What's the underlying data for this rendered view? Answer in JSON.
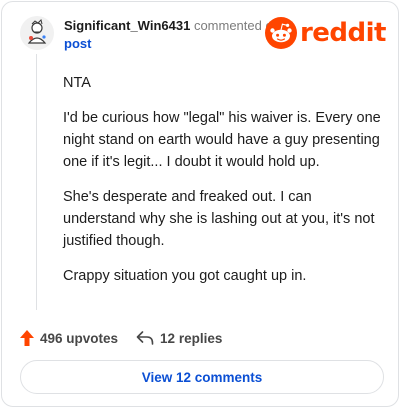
{
  "comment": {
    "author": "Significant_Win6431",
    "action_text": "commented on",
    "target_link": "post",
    "paragraphs": [
      "NTA",
      "I'd be curious how \"legal\" his waiver is. Every one night stand on earth would have a guy presenting one if it's legit... I doubt it would hold up.",
      "She's desperate and freaked out. I can understand why she is lashing out at you, it's not justified though.",
      "Crappy situation you got caught up in."
    ]
  },
  "brand": {
    "name": "reddit",
    "color": "#ff4500",
    "icon": "reddit-snoo-icon"
  },
  "actions": {
    "upvotes": "496 upvotes",
    "replies": "12 replies",
    "upvote_icon": "upvote-arrow-icon",
    "reply_icon": "reply-arrow-icon",
    "upvote_color": "#ff4500"
  },
  "footer": {
    "view_comments_label": "View 12 comments",
    "link_color": "#0b4fd4"
  }
}
